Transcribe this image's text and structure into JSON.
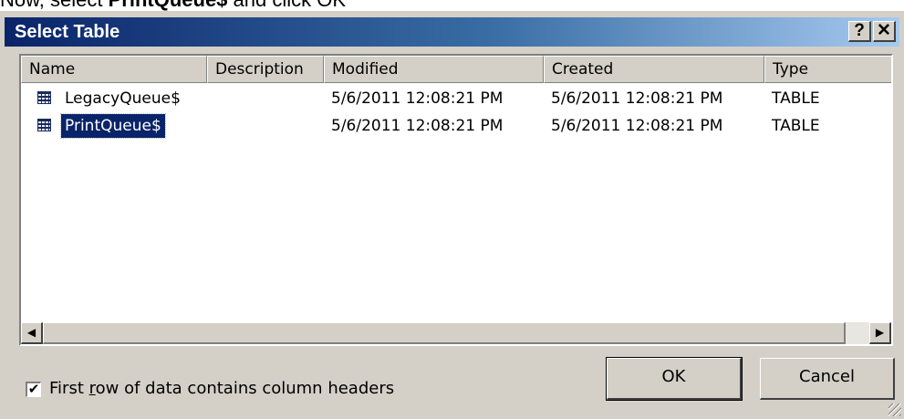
{
  "instruction": {
    "prefix": "Now, select ",
    "bold": "PrintQueue$",
    "suffix": " and click OK"
  },
  "dialog": {
    "title": "Select Table",
    "help_label": "?",
    "close_label": "✕"
  },
  "table": {
    "columns": [
      "Name",
      "Description",
      "Modified",
      "Created",
      "Type"
    ],
    "rows": [
      {
        "name": "LegacyQueue$",
        "description": "",
        "modified": "5/6/2011 12:08:21 PM",
        "created": "5/6/2011 12:08:21 PM",
        "type": "TABLE",
        "selected": false
      },
      {
        "name": "PrintQueue$",
        "description": "",
        "modified": "5/6/2011 12:08:21 PM",
        "created": "5/6/2011 12:08:21 PM",
        "type": "TABLE",
        "selected": true
      }
    ]
  },
  "scrollbar": {
    "left_arrow": "◀",
    "right_arrow": "▶"
  },
  "options": {
    "first_row_headers": {
      "checked": true,
      "check_glyph": "✔",
      "label_before": "First ",
      "label_underlined": "r",
      "label_after": "ow of data contains column headers"
    }
  },
  "buttons": {
    "ok": "OK",
    "cancel": "Cancel"
  },
  "icons": {
    "table_icon": "table-grid-icon"
  },
  "colors": {
    "titlebar_start": "#0a246a",
    "titlebar_end": "#a6caf0",
    "selection": "#0a246a",
    "dialog_bg": "#d4d0c8"
  }
}
